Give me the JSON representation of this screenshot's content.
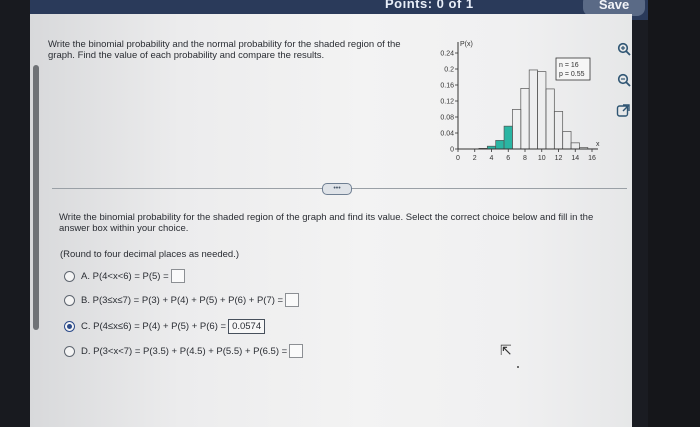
{
  "header": {
    "title_fragment": "Points: 0 of 1",
    "save_label": "Save"
  },
  "problem": {
    "text": "Write the binomial probability and the normal probability for the shaded region of the graph. Find the value of each probability and compare the results."
  },
  "graph": {
    "y_axis_label": "P(x)",
    "y_ticks": [
      "0.24",
      "0.2",
      "0.16",
      "0.12",
      "0.08",
      "0.04",
      "0"
    ],
    "x_ticks": [
      "0",
      "2",
      "4",
      "6",
      "8",
      "10",
      "12",
      "14",
      "16"
    ],
    "x_axis_label": "x",
    "legend_n": "n = 16",
    "legend_p": "p = 0.55",
    "bars": [
      0.0,
      0.0,
      0.0003,
      0.0016,
      0.007,
      0.0215,
      0.0571,
      0.0991,
      0.1516,
      0.1976,
      0.1934,
      0.1502,
      0.0939,
      0.0439,
      0.0154,
      0.0037,
      0.0005
    ],
    "shaded_x": [
      4,
      5,
      6
    ],
    "shade_color": "#2bb5a3"
  },
  "tools": {
    "zoom_in": "zoom-in-icon",
    "zoom_out": "zoom-out-icon",
    "popout": "popout-icon"
  },
  "question": {
    "instruction": "Write the binomial probability for the shaded region of the graph and find its value. Select the correct choice below and fill in the answer box within your choice.",
    "rounding": "(Round to four decimal places as needed.)",
    "choices": [
      {
        "letter": "A.",
        "expr": "P(4<x<6) = P(5) =",
        "answer": "",
        "selected": false
      },
      {
        "letter": "B.",
        "expr": "P(3≤x≤7) = P(3) + P(4) + P(5) + P(6) + P(7) =",
        "answer": "",
        "selected": false
      },
      {
        "letter": "C.",
        "expr": "P(4≤x≤6) = P(4) + P(5) + P(6) =",
        "answer": "0.0574",
        "selected": true
      },
      {
        "letter": "D.",
        "expr": "P(3<x<7) = P(3.5) + P(4.5) + P(5.5) + P(6.5) =",
        "answer": "",
        "selected": false
      }
    ]
  }
}
